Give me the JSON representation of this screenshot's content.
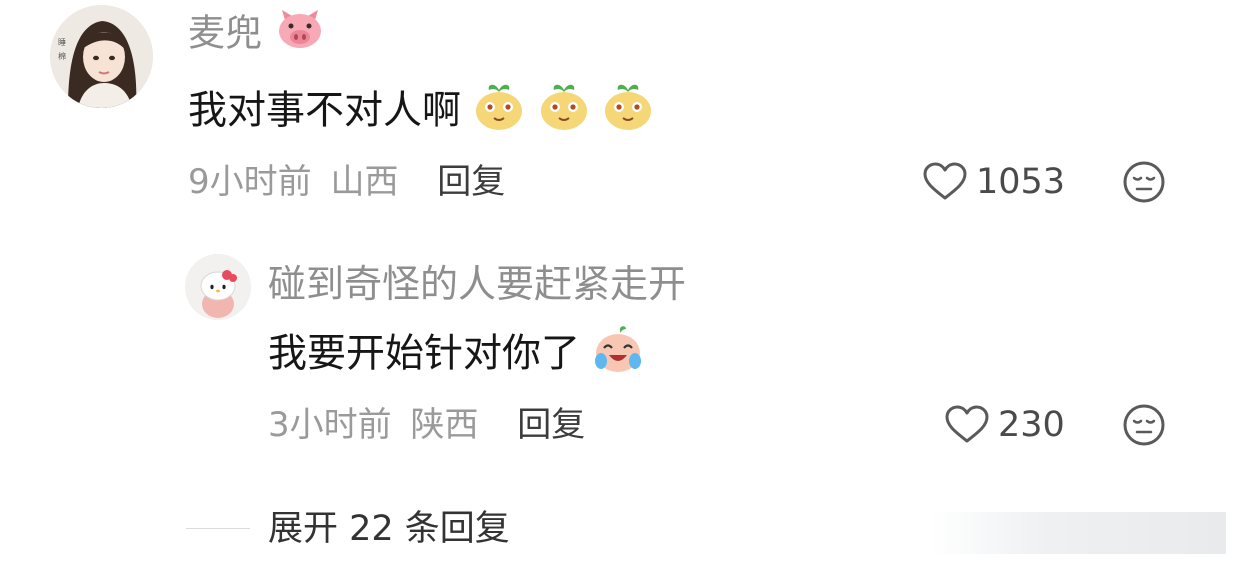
{
  "comment": {
    "user": "麦兜",
    "text": "我对事不对人啊",
    "time": "9小时前",
    "location": "山西",
    "reply_label": "回复",
    "likes": "1053",
    "user_badge_icon": "pig-face-emoji",
    "text_emoji_icon": "sprout-face-emoji",
    "text_emoji_count": 3
  },
  "reply": {
    "user": "碰到奇怪的人要赶紧走开",
    "text": "我要开始针对你了",
    "time": "3小时前",
    "location": "陕西",
    "reply_label": "回复",
    "likes": "230",
    "text_emoji_icon": "crying-laugh-emoji"
  },
  "expand": {
    "label": "展开 22 条回复"
  },
  "colors": {
    "name": "#8e8e8e",
    "meta": "#9a9a9a",
    "text": "#161616"
  }
}
